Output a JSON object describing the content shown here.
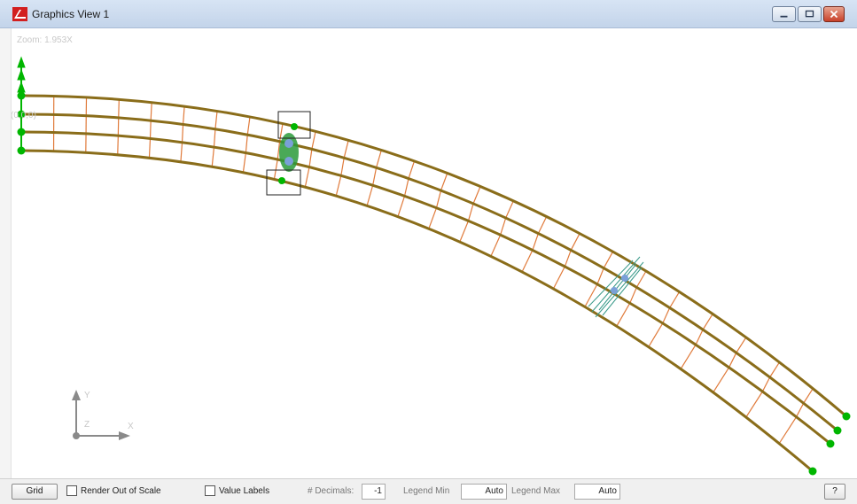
{
  "window": {
    "title": "Graphics View 1"
  },
  "canvas": {
    "zoom_label": "Zoom: 1.953X",
    "origin_label": "(0,0,0)"
  },
  "axes": {
    "y": "Y",
    "z": "Z",
    "x": "X"
  },
  "toolbar": {
    "grid_label": "Grid",
    "render_out_of_scale_label": "Render Out of Scale",
    "render_out_of_scale_checked": false,
    "value_labels_label": "Value Labels",
    "value_labels_checked": false,
    "decimals_label": "# Decimals:",
    "decimals_value": "-1",
    "legend_min_label": "Legend Min",
    "legend_min_value": "Auto",
    "legend_max_label": "Legend Max",
    "legend_max_value": "Auto",
    "help_label": "?"
  },
  "colors": {
    "girder": "#8a6d1a",
    "cross_frame": "#e07a3a",
    "support": "#00b600",
    "load_marker": "#3a9a8a",
    "selection_box": "#222222"
  }
}
